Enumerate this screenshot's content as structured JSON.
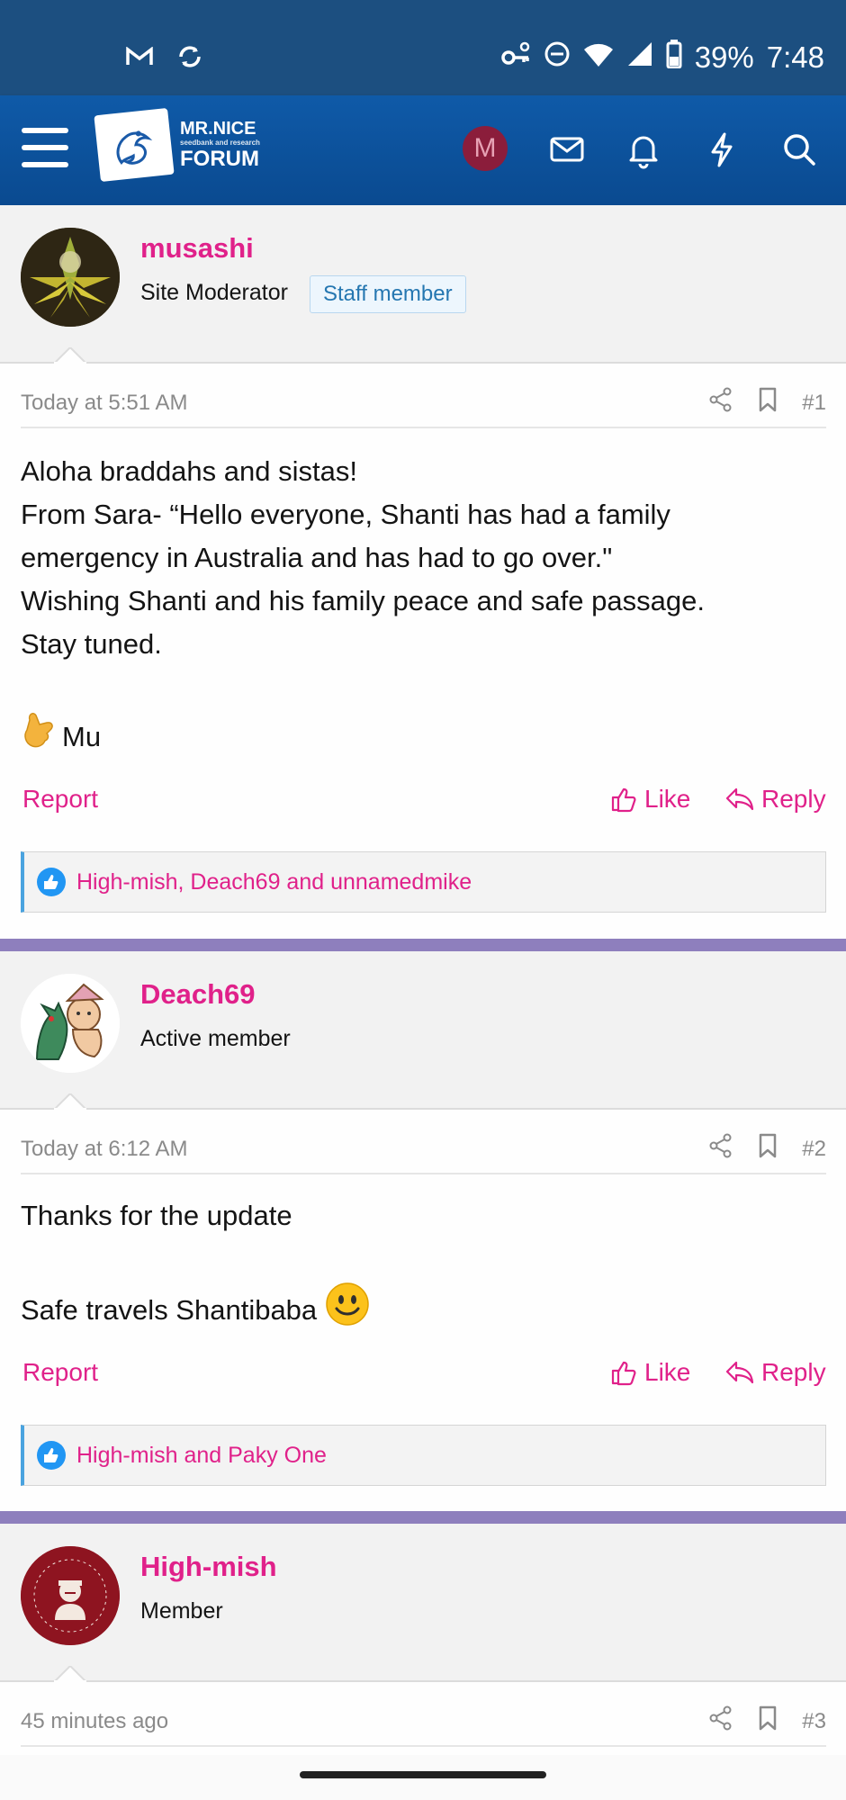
{
  "status_bar": {
    "battery": "39%",
    "time": "7:48"
  },
  "app_bar": {
    "logo_line1": "MR.NICE",
    "logo_line2": "seedbank and research",
    "logo_line3": "FORUM",
    "user_initial": "M",
    "colors": {
      "bar": "#0a4a90",
      "avatar": "#8b1d3b",
      "accent": "#e0218a"
    }
  },
  "posts": [
    {
      "username": "musashi",
      "role": "Site Moderator",
      "badge": "Staff member",
      "time": "Today at 5:51 AM",
      "number": "#1",
      "lines": [
        "Aloha braddahs and sistas!",
        "From Sara- “Hello everyone, Shanti has had a family",
        "emergency in Australia and has had to go over.\"",
        "Wishing Shanti and his family peace and safe passage.",
        "Stay tuned."
      ],
      "signature": "Mu",
      "report": "Report",
      "like": "Like",
      "reply": "Reply",
      "likes": "High-mish, Deach69 and unnamedmike"
    },
    {
      "username": "Deach69",
      "role": "Active member",
      "time": "Today at 6:12 AM",
      "number": "#2",
      "line1": "Thanks for the update",
      "line2": "Safe travels Shantibaba",
      "report": "Report",
      "like": "Like",
      "reply": "Reply",
      "likes": "High-mish and Paky One"
    },
    {
      "username": "High-mish",
      "role": "Member",
      "time": "45 minutes ago",
      "number": "#3"
    }
  ]
}
